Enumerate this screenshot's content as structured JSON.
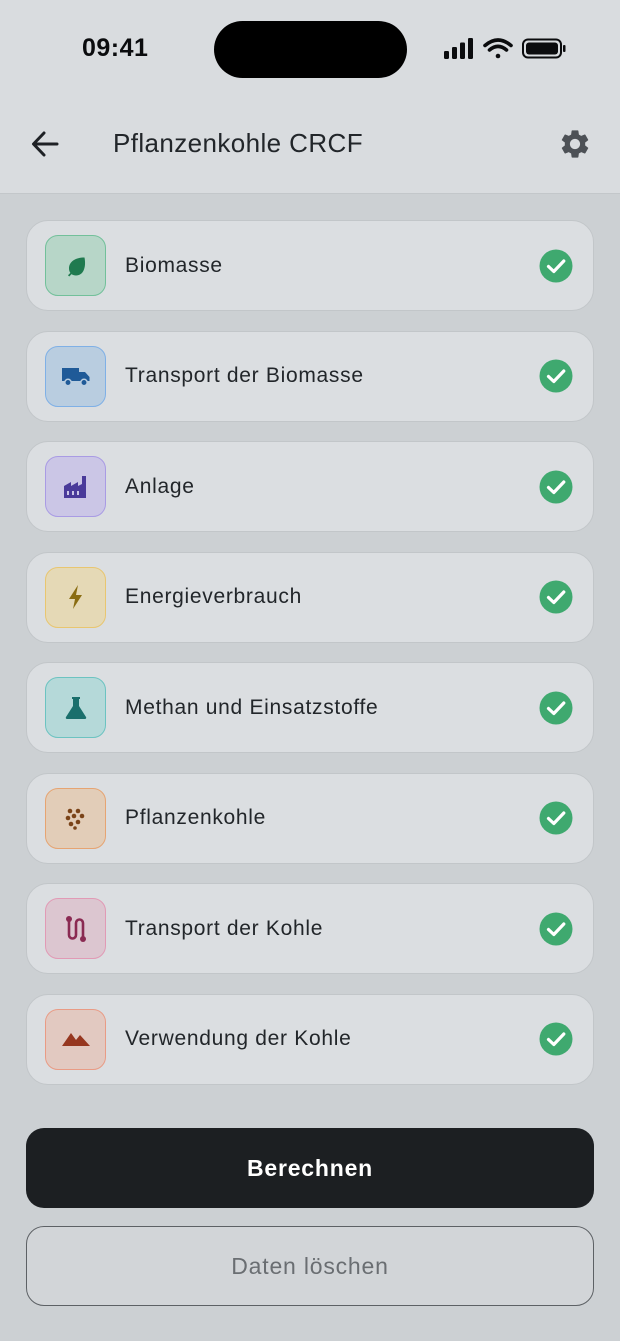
{
  "status_bar": {
    "time": "09:41",
    "icons": [
      "signal-icon",
      "wifi-icon",
      "battery-icon"
    ]
  },
  "header": {
    "title": "Pflanzenkohle CRCF",
    "back_icon": "arrow-left-icon",
    "settings_icon": "gear-icon"
  },
  "sections": [
    {
      "label": "Biomasse",
      "icon": "leaf-icon",
      "tile_bg": "#b7d6c8",
      "tile_border": "#72c09a",
      "icon_color": "#1f7a4f",
      "completed": true
    },
    {
      "label": "Transport der Biomasse",
      "icon": "truck-icon",
      "tile_bg": "#b9cde0",
      "tile_border": "#7fb0e6",
      "icon_color": "#1f5a98",
      "completed": true
    },
    {
      "label": "Anlage",
      "icon": "factory-icon",
      "tile_bg": "#cbc6e6",
      "tile_border": "#a99be4",
      "icon_color": "#4a3a9a",
      "completed": true
    },
    {
      "label": "Energieverbrauch",
      "icon": "lightning-icon",
      "tile_bg": "#e5d9b6",
      "tile_border": "#e8c670",
      "icon_color": "#8a6d12",
      "completed": true
    },
    {
      "label": "Methan und Einsatzstoffe",
      "icon": "flask-icon",
      "tile_bg": "#b5d9d9",
      "tile_border": "#6cc3c1",
      "icon_color": "#1a6f6c",
      "completed": true
    },
    {
      "label": "Pflanzenkohle",
      "icon": "granules-icon",
      "tile_bg": "#e2cdb8",
      "tile_border": "#e6a472",
      "icon_color": "#7a4318",
      "completed": true
    },
    {
      "label": "Transport der Kohle",
      "icon": "route-icon",
      "tile_bg": "#dcc6d0",
      "tile_border": "#e19ab5",
      "icon_color": "#8a2a52",
      "completed": true
    },
    {
      "label": "Verwendung der Kohle",
      "icon": "mountains-icon",
      "tile_bg": "#e2c9c1",
      "tile_border": "#e99b85",
      "icon_color": "#963720",
      "completed": true
    }
  ],
  "colors": {
    "check": "#3fa96f",
    "primary_button": "#1c1f22"
  },
  "actions": {
    "calculate_label": "Berechnen",
    "clear_label": "Daten löschen"
  }
}
